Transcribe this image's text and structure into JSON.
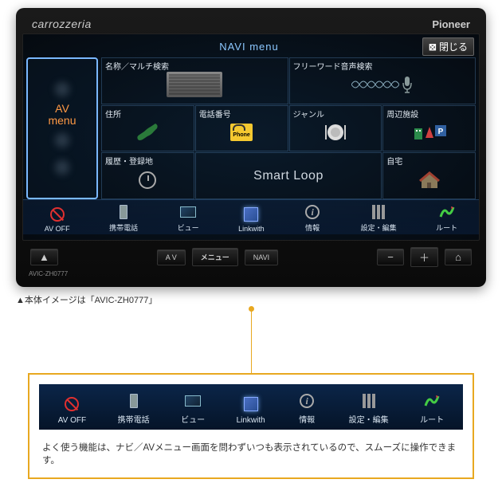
{
  "brand": {
    "left": "carrozzeria",
    "right": "Pioneer"
  },
  "screen": {
    "title": "NAVI menu",
    "close": "閉じる",
    "av_side": {
      "line1": "AV",
      "line2": "menu"
    },
    "cells": {
      "name_multi": "名称／マルチ検索",
      "freeword": "フリーワード音声検索",
      "address": "住所",
      "phone": "電話番号",
      "phone_badge": "Phone",
      "genre": "ジャンル",
      "surround": "周辺施設",
      "history": "履歴・登録地",
      "smartloop": "Smart Loop",
      "home": "自宅"
    }
  },
  "bottom": {
    "avoff": "AV OFF",
    "mobile": "携帯電話",
    "view": "ビュー",
    "linkwith": "Linkwith",
    "info": "情報",
    "settings": "設定・編集",
    "route": "ルート"
  },
  "hw": {
    "eject": "▲",
    "av": "A V",
    "menu": "メニュー",
    "navi": "NAVI",
    "minus": "−",
    "plus": "＋",
    "home": "⌂"
  },
  "model": "AVIC-ZH0777",
  "caption": "▲本体イメージは「AVIC-ZH0777」",
  "callout_text": "よく使う機能は、ナビ／AVメニュー画面を問わずいつも表示されているので、スムーズに操作できます。"
}
